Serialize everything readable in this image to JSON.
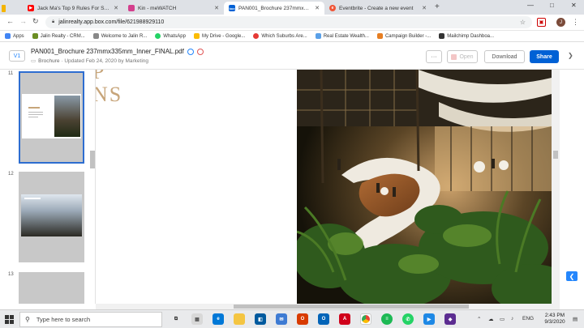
{
  "browser": {
    "tabs": [
      {
        "label": "Jack Ma's Top 9 Rules For Succes",
        "favicon_color": "#ff0000"
      },
      {
        "label": "Kin - meWATCH",
        "favicon_color": "#d43f8d"
      },
      {
        "label": "PAN001_Brochure 237mmx335m",
        "favicon_color": "#0061d5"
      },
      {
        "label": "Eventbrite - Create a new event",
        "favicon_color": "#f05537"
      }
    ],
    "new_tab": "+",
    "url": "jalinrealty.app.box.com/file/621988929110",
    "window_controls": {
      "minimize": "—",
      "maximize": "□",
      "close": "✕"
    },
    "profile_initial": "J",
    "bookmarks": [
      {
        "label": "Apps",
        "color": "#4285f4"
      },
      {
        "label": "Jalin Realty - CRM...",
        "color": "#6b8e23"
      },
      {
        "label": "Welcome to Jalin R...",
        "color": "#888888"
      },
      {
        "label": "WhatsApp",
        "color": "#25d366"
      },
      {
        "label": "My Drive - Google...",
        "color": "#fbbc04"
      },
      {
        "label": "Which Suburbs Are...",
        "color": "#e53935"
      },
      {
        "label": "Real Estate Wealth...",
        "color": "#5aa0e8"
      },
      {
        "label": "Campaign Builder -...",
        "color": "#e67e22"
      },
      {
        "label": "Mailchimp Dashboa...",
        "color": "#333333"
      }
    ]
  },
  "box": {
    "version": "V1",
    "file_name": "PAN001_Brochure 237mmx335mm_Inner_FINAL.pdf",
    "folder": "Brochure",
    "updated": "· Updated Feb 24, 2020 by Marketing",
    "more_label": "···",
    "open_label": "Open",
    "download_label": "Download",
    "share_label": "Share",
    "accent": "#0061d5"
  },
  "thumbnails": {
    "pages": [
      "11",
      "12",
      "13"
    ]
  },
  "document": {
    "serif_fragment_1": "P",
    "serif_fragment_2": "NS"
  },
  "taskbar": {
    "search_placeholder": "Type here to search",
    "language": "ENG",
    "time": "2:43 PM",
    "date": "9/3/2020"
  }
}
